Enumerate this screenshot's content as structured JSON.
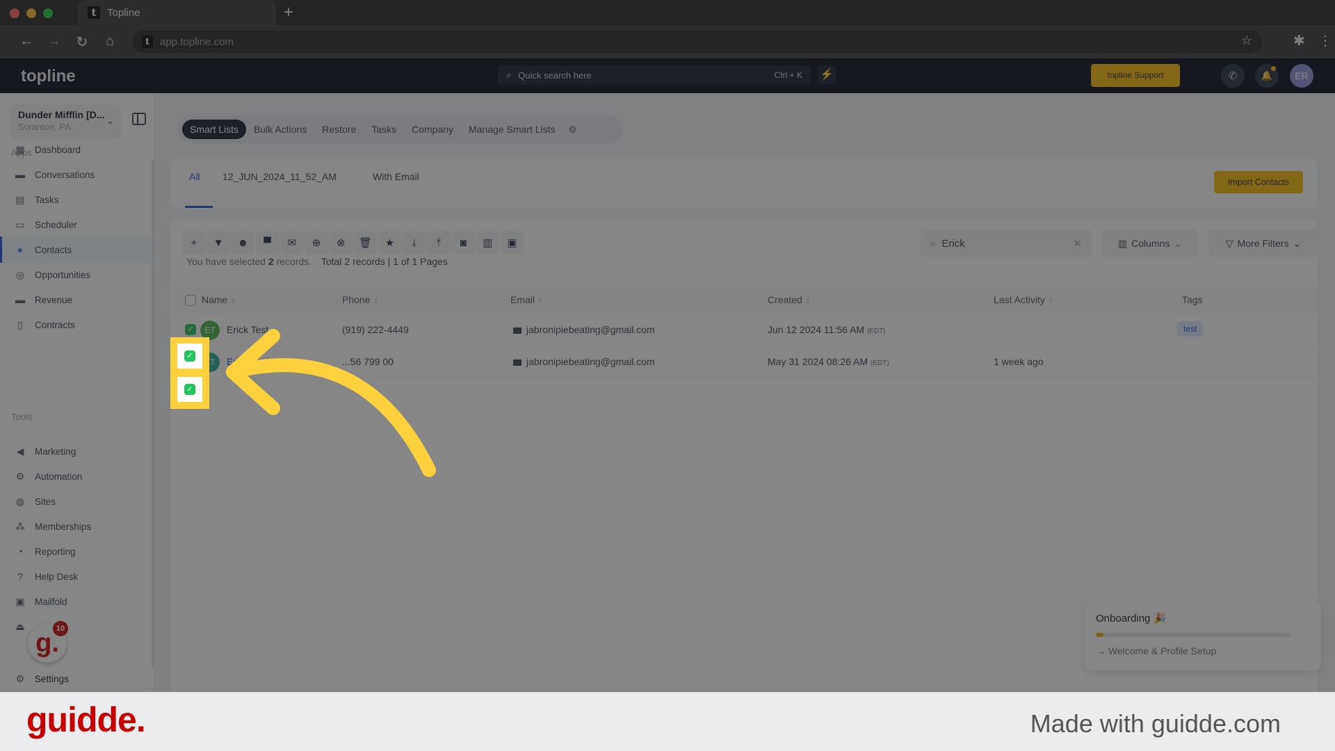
{
  "browser": {
    "tab_title": "Topline",
    "favicon_letter": "t",
    "new_tab": "+",
    "url": "app.topline.com",
    "nav": {
      "back": "←",
      "forward": "→",
      "reload": "↻",
      "home": "⌂"
    },
    "bookmark_icon": "☆",
    "extensions_icon": "✱",
    "menu_icon": "⋮"
  },
  "header": {
    "logo": "topline",
    "search_placeholder": "Quick search here",
    "search_shortcut": "Ctrl + K",
    "bolt_icon": "⚡",
    "support_label": "topline Support",
    "phone_icon": "✆",
    "bell_icon": "🔔",
    "avatar_initials": "ER"
  },
  "account": {
    "name": "Dunder Mifflin [D...",
    "location": "Scranton, PA"
  },
  "sidebar": {
    "apps_label": "Apps",
    "tools_label": "Tools",
    "apps": [
      {
        "label": "Dashboard",
        "icon": "▦"
      },
      {
        "label": "Conversations",
        "icon": "▬"
      },
      {
        "label": "Tasks",
        "icon": "▤"
      },
      {
        "label": "Scheduler",
        "icon": "▭"
      },
      {
        "label": "Contacts",
        "icon": "●",
        "active": true
      },
      {
        "label": "Opportunities",
        "icon": "◎"
      },
      {
        "label": "Revenue",
        "icon": "▬"
      },
      {
        "label": "Contracts",
        "icon": "▯"
      }
    ],
    "tools": [
      {
        "label": "Marketing",
        "icon": "◀"
      },
      {
        "label": "Automation",
        "icon": "⚙"
      },
      {
        "label": "Sites",
        "icon": "◍"
      },
      {
        "label": "Memberships",
        "icon": "⁂"
      },
      {
        "label": "Reporting",
        "icon": "◔"
      },
      {
        "label": "Help Desk",
        "icon": "?"
      },
      {
        "label": "Mailfold",
        "icon": "▣"
      },
      {
        "label": "",
        "icon": "⏏"
      }
    ],
    "settings": {
      "label": "Settings",
      "icon": "⚙"
    }
  },
  "guidde_widget": {
    "letter": "g.",
    "badge": "10"
  },
  "subnav": {
    "items": [
      "Smart Lists",
      "Bulk Actions",
      "Restore",
      "Tasks",
      "Company",
      "Manage Smart Lists"
    ],
    "active": "Smart Lists",
    "gear_icon": "⚙"
  },
  "list_tabs": {
    "items": [
      "All",
      "12_JUN_2024_11_52_AM",
      "With Email"
    ],
    "active": "All"
  },
  "import_label": "Import Contacts",
  "toolbar": {
    "icons": [
      {
        "name": "add",
        "glyph": "+"
      },
      {
        "name": "filter",
        "glyph": "▼"
      },
      {
        "name": "robot",
        "glyph": "☻"
      },
      {
        "name": "sms",
        "glyph": "▀"
      },
      {
        "name": "email",
        "glyph": "✉"
      },
      {
        "name": "add-tag",
        "glyph": "⊕"
      },
      {
        "name": "remove-tag",
        "glyph": "⊗"
      },
      {
        "name": "delete",
        "glyph": "🗑"
      },
      {
        "name": "star",
        "glyph": "★"
      },
      {
        "name": "import",
        "glyph": "⤓"
      },
      {
        "name": "export",
        "glyph": "⤒"
      },
      {
        "name": "merge",
        "glyph": "◙"
      },
      {
        "name": "company",
        "glyph": "▥"
      },
      {
        "name": "image",
        "glyph": "▣"
      }
    ],
    "search_value": "Erick",
    "clear_icon": "✕",
    "columns_label": "Columns",
    "more_filters_label": "More Filters"
  },
  "selection": {
    "prefix": "You have selected",
    "count": "2",
    "suffix": "records.",
    "total": "Total 2 records | 1 of 1 Pages"
  },
  "table": {
    "columns": [
      "Name",
      "Phone",
      "Email",
      "Created",
      "Last Activity",
      "Tags"
    ],
    "rows": [
      {
        "initials": "ET",
        "avatar_color": "#4caf50",
        "name": "Erick Test",
        "phone": "(919) 222-4449",
        "email": "jabronipiebeating@gmail.com",
        "created": "Jun 12 2024 11:56 AM",
        "tz": "(EDT)",
        "last_activity": "",
        "tag": "test",
        "checked": true
      },
      {
        "initials": "ET",
        "avatar_color": "#26a69a",
        "name": "Erick Test",
        "phone": "...56 799 00",
        "email": "jabronipiebeating@gmail.com",
        "created": "May 31 2024 08:26 AM",
        "tz": "(EDT)",
        "last_activity": "1 week ago",
        "tag": "",
        "checked": true
      }
    ]
  },
  "onboarding": {
    "title": "Onboarding 🎉",
    "progress": 0.04,
    "step": "→ Welcome & Profile Setup"
  },
  "guidde_footer": {
    "logo": "guidde.",
    "tagline": "Made with guidde.com"
  },
  "colors": {
    "accent": "#f5b800",
    "primary": "#1d4ed8",
    "annotation": "#fdd13d",
    "guidde": "#c40000"
  }
}
